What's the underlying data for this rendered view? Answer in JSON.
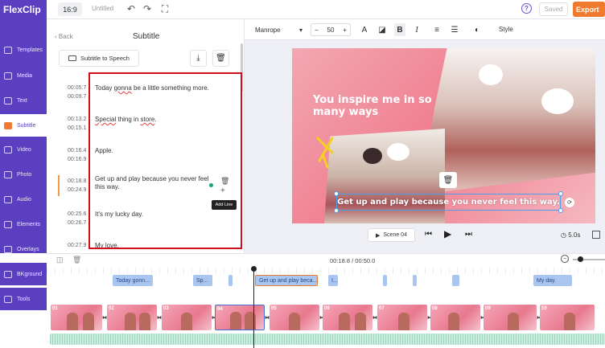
{
  "app": {
    "logo": "FlexClip",
    "ratio": "16:9",
    "doc_title": "Untitled",
    "saved": "Saved",
    "export": "Export",
    "help": "?"
  },
  "sidebar": {
    "items": [
      {
        "label": "Templates",
        "icon": "templates-icon"
      },
      {
        "label": "Media",
        "icon": "media-icon"
      },
      {
        "label": "Text",
        "icon": "text-icon"
      },
      {
        "label": "Subtitle",
        "icon": "subtitle-icon"
      },
      {
        "label": "Video",
        "icon": "video-icon"
      },
      {
        "label": "Photo",
        "icon": "photo-icon"
      },
      {
        "label": "Audio",
        "icon": "audio-icon"
      },
      {
        "label": "Elements",
        "icon": "elements-icon"
      },
      {
        "label": "Overlays",
        "icon": "overlays-icon"
      },
      {
        "label": "BKground",
        "icon": "background-icon"
      },
      {
        "label": "Tools",
        "icon": "tools-icon"
      }
    ],
    "active": "Subtitle"
  },
  "panel": {
    "back": "Back",
    "title": "Subtitle",
    "subtitle_to_speech": "Subtitle to Speech",
    "tooltip": "Add Line",
    "subtitles": [
      {
        "start": "00:05.7",
        "end": "00:09.7",
        "text_before": "Today ",
        "text_wavy": "gonna",
        "text_after": " be a little something more."
      },
      {
        "start": "00:13.2",
        "end": "00:15.1",
        "text_before": "",
        "text_wavy": "Special",
        "text_after": " thing in ",
        "text_wavy2": "store",
        "text_end": "."
      },
      {
        "start": "00:16.4",
        "end": "00:16.9",
        "text_before": "Apple.",
        "text_wavy": "",
        "text_after": ""
      },
      {
        "start": "00:18.8",
        "end": "00:24.9",
        "text_before": "Get up and play because you never feel this way.",
        "text_wavy": "",
        "text_after": ""
      },
      {
        "start": "00:25.6",
        "end": "00:26.7",
        "text_before": "It's my lucky day.",
        "text_wavy": "",
        "text_after": ""
      },
      {
        "start": "00:27.9",
        "end": "",
        "text_before": "My love.",
        "text_wavy": "",
        "text_after": ""
      }
    ]
  },
  "format_bar": {
    "font": "Manrope",
    "size": "50",
    "minus": "−",
    "plus": "+",
    "style": "Style"
  },
  "canvas": {
    "headline": "You inspire me in so many ways",
    "caption": "Get up and play because you never feel this way."
  },
  "player": {
    "scene": "Scene 04",
    "duration": "5.0s"
  },
  "timeline": {
    "time": "00:18.8 / 00:50.0",
    "subtitle_clips": [
      {
        "label": "Today gonn..."
      },
      {
        "label": "Sp..."
      },
      {
        "label": ""
      },
      {
        "label": "Get up and play beca..."
      },
      {
        "label": "I..."
      },
      {
        "label": ""
      },
      {
        "label": ""
      },
      {
        "label": ""
      },
      {
        "label": "My day."
      }
    ],
    "scenes": [
      "01",
      "02",
      "03",
      "04",
      "05",
      "06",
      "07",
      "08",
      "09",
      "10"
    ]
  },
  "colors": {
    "brand": "#5a3fc0",
    "accent": "#f07a2e",
    "highlight": "#d0101a"
  }
}
